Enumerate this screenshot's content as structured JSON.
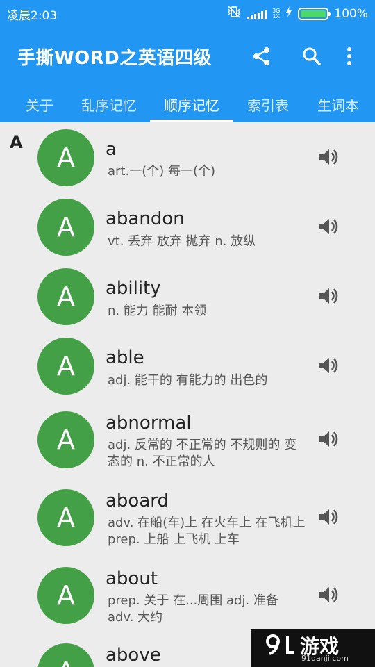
{
  "status_bar": {
    "time": "凌晨2:03",
    "network": [
      "3G",
      "1X"
    ],
    "battery_text": "100%",
    "battery_level": 1.0,
    "icons": [
      "vibrate-off-icon",
      "signal-icon",
      "charging-icon",
      "battery-icon"
    ]
  },
  "app_bar": {
    "title": "手撕WORD之英语四级",
    "actions": [
      "share-icon",
      "search-icon",
      "more-vert-icon"
    ]
  },
  "tabs": [
    {
      "label": "关于",
      "active": false
    },
    {
      "label": "乱序记忆",
      "active": false
    },
    {
      "label": "顺序记忆",
      "active": true
    },
    {
      "label": "索引表",
      "active": false
    },
    {
      "label": "生词本",
      "active": false
    }
  ],
  "section": {
    "letter": "A"
  },
  "words": [
    {
      "initial": "A",
      "word": "a",
      "meaning": "art.一(个) 每一(个)"
    },
    {
      "initial": "A",
      "word": "abandon",
      "meaning": "vt. 丢弃 放弃 抛弃 n. 放纵"
    },
    {
      "initial": "A",
      "word": "ability",
      "meaning": "n. 能力 能耐 本领"
    },
    {
      "initial": "A",
      "word": "able",
      "meaning": "adj. 能干的 有能力的 出色的"
    },
    {
      "initial": "A",
      "word": "abnormal",
      "meaning": "adj. 反常的 不正常的 不规则的 变态的 n. 不正常的人"
    },
    {
      "initial": "A",
      "word": "aboard",
      "meaning": "adv. 在船(车)上 在火车上 在飞机上 prep. 上船 上飞机 上车"
    },
    {
      "initial": "A",
      "word": "about",
      "meaning": "prep. 关于 在...周围 adj. 准备 adv. 大约"
    },
    {
      "initial": "A",
      "word": "above",
      "meaning": ""
    }
  ],
  "watermark": {
    "logo_text": "游戏",
    "site": "91danji.com"
  },
  "colors": {
    "primary": "#2196f3",
    "avatar": "#43a047",
    "background": "#ececec",
    "battery": "#4cd964"
  }
}
